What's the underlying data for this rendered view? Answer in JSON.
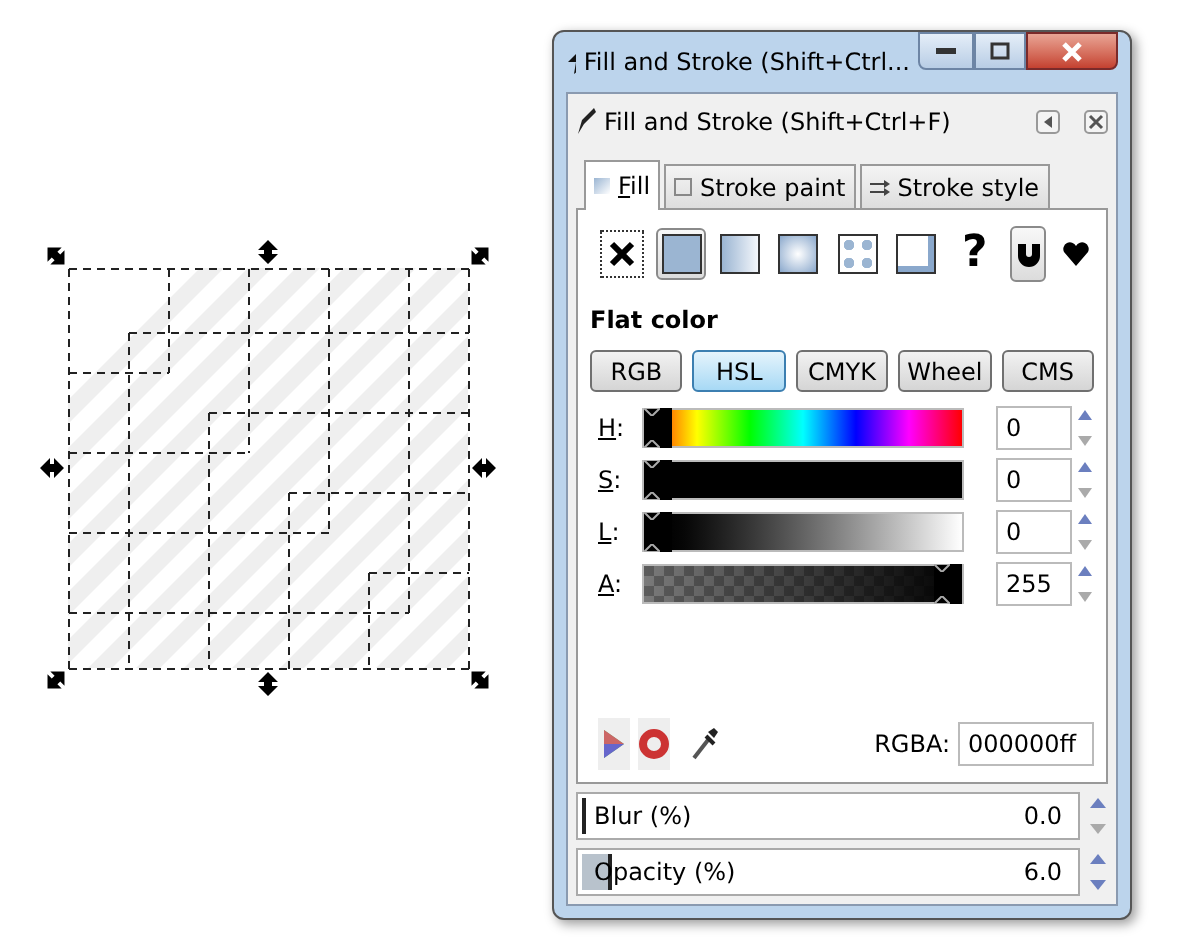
{
  "window": {
    "title": "Fill and Stroke (Shift+Ctrl..."
  },
  "panel": {
    "title": "Fill and Stroke (Shift+Ctrl+F)"
  },
  "tabs": [
    {
      "label": "Fill",
      "selected": true
    },
    {
      "label": "Stroke paint",
      "selected": false
    },
    {
      "label": "Stroke style",
      "selected": false
    }
  ],
  "paint_types": [
    {
      "kind": "none",
      "selected": false
    },
    {
      "kind": "flat",
      "selected": true
    },
    {
      "kind": "linear",
      "selected": false
    },
    {
      "kind": "radial",
      "selected": false
    },
    {
      "kind": "pattern",
      "selected": false
    },
    {
      "kind": "swatch",
      "selected": false
    },
    {
      "kind": "unset",
      "label": "?",
      "selected": false
    }
  ],
  "fill_rules": [
    {
      "kind": "evenodd",
      "selected": true
    },
    {
      "kind": "nonzero",
      "selected": false
    }
  ],
  "paint_heading": "Flat color",
  "color_modes": [
    {
      "label": "RGB",
      "selected": false
    },
    {
      "label": "HSL",
      "selected": true
    },
    {
      "label": "CMYK",
      "selected": false
    },
    {
      "label": "Wheel",
      "selected": false
    },
    {
      "label": "CMS",
      "selected": false
    }
  ],
  "channels": [
    {
      "kind": "hue",
      "label": "H:",
      "level": 0,
      "value": "0"
    },
    {
      "kind": "saturation",
      "label": "S:",
      "level": 0,
      "value": "0"
    },
    {
      "kind": "lightness",
      "label": "L:",
      "level": 0,
      "value": "0"
    },
    {
      "kind": "alpha",
      "label": "A:",
      "level": 1,
      "value": "255"
    }
  ],
  "rgba": {
    "label": "RGBA:",
    "value": "000000ff"
  },
  "blur": {
    "label": "Blur (%)",
    "value": "0.0",
    "level": 0
  },
  "opacity": {
    "label": "Opacity (%)",
    "value": "6.0",
    "level": 0.06
  }
}
